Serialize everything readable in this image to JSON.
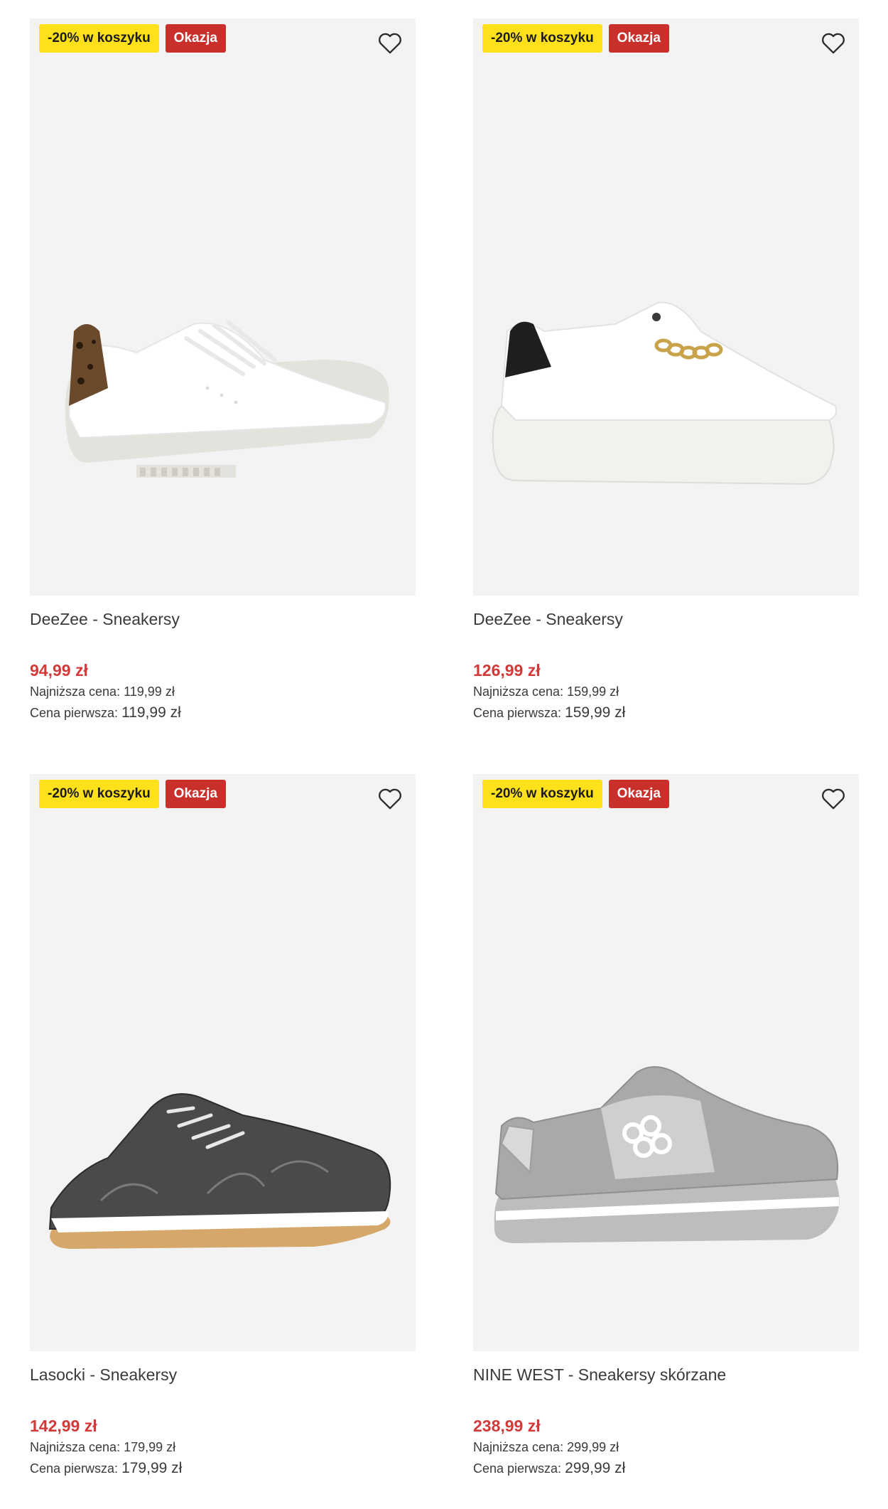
{
  "products": [
    {
      "badge_promo": "-20% w koszyku",
      "badge_deal": "Okazja",
      "name": "DeeZee - Sneakersy",
      "price": "94,99 zł",
      "lowest_label": "Najniższa cena:",
      "lowest_value": "119,99 zł",
      "first_label": "Cena pierwsza:",
      "first_value": "119,99 zł"
    },
    {
      "badge_promo": "-20% w koszyku",
      "badge_deal": "Okazja",
      "name": "DeeZee - Sneakersy",
      "price": "126,99 zł",
      "lowest_label": "Najniższa cena:",
      "lowest_value": "159,99 zł",
      "first_label": "Cena pierwsza:",
      "first_value": "159,99 zł"
    },
    {
      "badge_promo": "-20% w koszyku",
      "badge_deal": "Okazja",
      "name": "Lasocki - Sneakersy",
      "price": "142,99 zł",
      "lowest_label": "Najniższa cena:",
      "lowest_value": "179,99 zł",
      "first_label": "Cena pierwsza:",
      "first_value": "179,99 zł"
    },
    {
      "badge_promo": "-20% w koszyku",
      "badge_deal": "Okazja",
      "name": "NINE WEST - Sneakersy skórzane",
      "price": "238,99 zł",
      "lowest_label": "Najniższa cena:",
      "lowest_value": "299,99 zł",
      "first_label": "Cena pierwsza:",
      "first_value": "299,99 zł"
    }
  ],
  "icons": {
    "favorite": "heart-outline-icon"
  },
  "colors": {
    "promo_badge_bg": "#ffe11b",
    "deal_badge_bg": "#c9302c",
    "sale_price": "#d23a3a",
    "image_bg": "#f3f3f3"
  }
}
